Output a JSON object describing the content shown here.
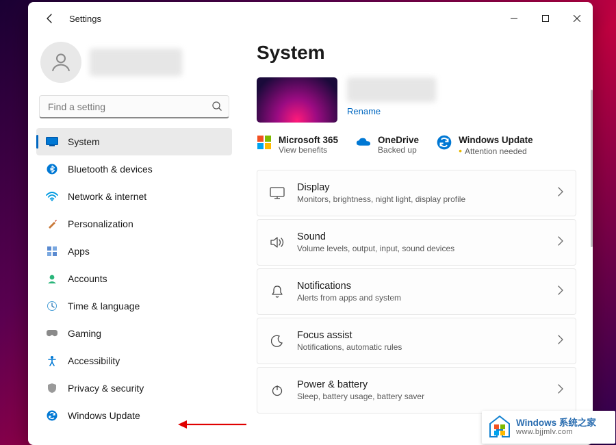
{
  "window": {
    "title": "Settings"
  },
  "search": {
    "placeholder": "Find a setting"
  },
  "sidebar": {
    "items": [
      {
        "label": "System"
      },
      {
        "label": "Bluetooth & devices"
      },
      {
        "label": "Network & internet"
      },
      {
        "label": "Personalization"
      },
      {
        "label": "Apps"
      },
      {
        "label": "Accounts"
      },
      {
        "label": "Time & language"
      },
      {
        "label": "Gaming"
      },
      {
        "label": "Accessibility"
      },
      {
        "label": "Privacy & security"
      },
      {
        "label": "Windows Update"
      }
    ]
  },
  "main": {
    "heading": "System",
    "rename": "Rename",
    "info": [
      {
        "title": "Microsoft 365",
        "sub": "View benefits"
      },
      {
        "title": "OneDrive",
        "sub": "Backed up"
      },
      {
        "title": "Windows Update",
        "sub": "Attention needed"
      }
    ],
    "cards": [
      {
        "title": "Display",
        "sub": "Monitors, brightness, night light, display profile"
      },
      {
        "title": "Sound",
        "sub": "Volume levels, output, input, sound devices"
      },
      {
        "title": "Notifications",
        "sub": "Alerts from apps and system"
      },
      {
        "title": "Focus assist",
        "sub": "Notifications, automatic rules"
      },
      {
        "title": "Power & battery",
        "sub": "Sleep, battery usage, battery saver"
      }
    ]
  },
  "watermark": {
    "line1": "Windows 系统之家",
    "line2": "www.bjjmlv.com"
  }
}
